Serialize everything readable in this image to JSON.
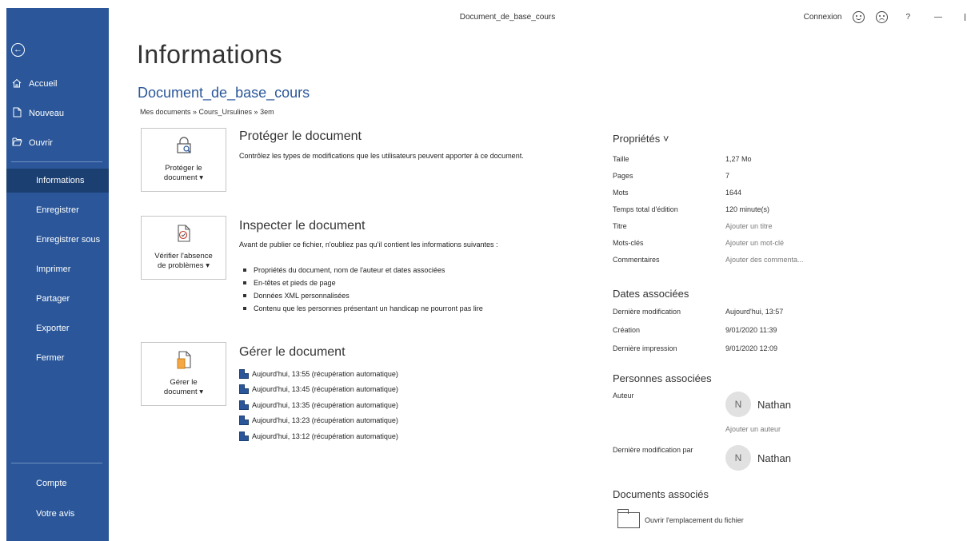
{
  "titlebar": {
    "title": "Document_de_base_cours",
    "signin": "Connexion",
    "help": "?",
    "minimize": "—"
  },
  "sidebar": {
    "items": [
      {
        "label": "Accueil",
        "icon": "home-icon"
      },
      {
        "label": "Nouveau",
        "icon": "new-document-icon"
      },
      {
        "label": "Ouvrir",
        "icon": "folder-open-icon"
      },
      {
        "label": "Informations",
        "active": true
      },
      {
        "label": "Enregistrer"
      },
      {
        "label": "Enregistrer sous"
      },
      {
        "label": "Imprimer"
      },
      {
        "label": "Partager"
      },
      {
        "label": "Exporter"
      },
      {
        "label": "Fermer"
      },
      {
        "label": "Compte"
      },
      {
        "label": "Votre avis"
      }
    ],
    "accent_color": "#2b579a",
    "active_color": "#1b3f70"
  },
  "main": {
    "title": "Informations",
    "doc_name": "Document_de_base_cours",
    "breadcrumb": "Mes documents » Cours_Ursulines » 3em",
    "protect": {
      "button_line1": "Protéger le",
      "button_line2": "document ▾",
      "title": "Protéger le document",
      "description": "Contrôlez les types de modifications que les utilisateurs peuvent apporter à ce document."
    },
    "inspect": {
      "button_line1": "Vérifier l'absence",
      "button_line2": "de problèmes ▾",
      "title": "Inspecter le document",
      "description": "Avant de publier ce fichier, n'oubliez pas qu'il contient les informations suivantes :",
      "bullets": [
        "Propriétés du document, nom de l'auteur et dates associées",
        "En-têtes et pieds de page",
        "Données XML personnalisées",
        "Contenu que les personnes présentant un handicap ne pourront pas lire"
      ]
    },
    "manage": {
      "button_line1": "Gérer le",
      "button_line2": "document ▾",
      "title": "Gérer le document",
      "versions": [
        "Aujourd'hui, 13:55 (récupération automatique)",
        "Aujourd'hui, 13:45 (récupération automatique)",
        "Aujourd'hui, 13:35 (récupération automatique)",
        "Aujourd'hui, 13:23 (récupération automatique)",
        "Aujourd'hui, 13:12 (récupération automatique)"
      ]
    }
  },
  "properties": {
    "header": "Propriétés ˅",
    "rows": [
      {
        "key": "Taille",
        "value": "1,27 Mo"
      },
      {
        "key": "Pages",
        "value": "7"
      },
      {
        "key": "Mots",
        "value": "1644"
      },
      {
        "key": "Temps total d'édition",
        "value": "120 minute(s)"
      },
      {
        "key": "Titre",
        "value": "Ajouter un titre"
      },
      {
        "key": "Mots-clés",
        "value": "Ajouter un mot-clé"
      },
      {
        "key": "Commentaires",
        "value": "Ajouter des commenta..."
      }
    ],
    "dates_header": "Dates associées",
    "dates": [
      {
        "key": "Dernière modification",
        "value": "Aujourd'hui, 13:57"
      },
      {
        "key": "Création",
        "value": "9/01/2020 11:39"
      },
      {
        "key": "Dernière impression",
        "value": "9/01/2020 12:09"
      }
    ],
    "people_header": "Personnes associées",
    "author_label": "Auteur",
    "author_initial": "N",
    "author_name": "Nathan",
    "add_author": "Ajouter un auteur",
    "last_modified_by_label": "Dernière modification par",
    "modifier_initial": "N",
    "modifier_name": "Nathan",
    "docs_header": "Documents associés",
    "open_location": "Ouvrir l'emplacement du fichier"
  }
}
